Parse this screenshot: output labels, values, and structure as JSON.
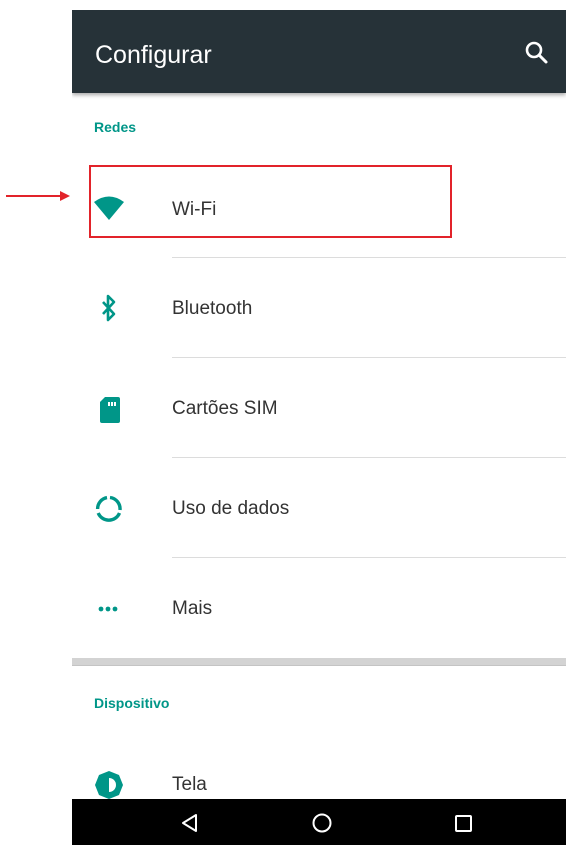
{
  "app_bar": {
    "title": "Configurar",
    "search_icon": "search-icon"
  },
  "sections": [
    {
      "header": "Redes",
      "items": [
        {
          "label": "Wi-Fi",
          "icon": "wifi-icon"
        },
        {
          "label": "Bluetooth",
          "icon": "bluetooth-icon"
        },
        {
          "label": "Cartões SIM",
          "icon": "sim-card-icon"
        },
        {
          "label": "Uso de dados",
          "icon": "data-usage-icon"
        },
        {
          "label": "Mais",
          "icon": "more-horiz-icon"
        }
      ]
    },
    {
      "header": "Dispositivo",
      "items": [
        {
          "label": "Tela",
          "icon": "brightness-icon"
        }
      ]
    }
  ],
  "nav_bar": {
    "back_icon": "back-triangle-icon",
    "home_icon": "home-circle-icon",
    "recents_icon": "recents-square-icon"
  },
  "annotation": {
    "highlight_color": "#e2232a",
    "target": "Wi-Fi"
  },
  "colors": {
    "app_bar": "#263238",
    "accent": "#009688",
    "text": "#333333",
    "nav_bar": "#000000"
  }
}
